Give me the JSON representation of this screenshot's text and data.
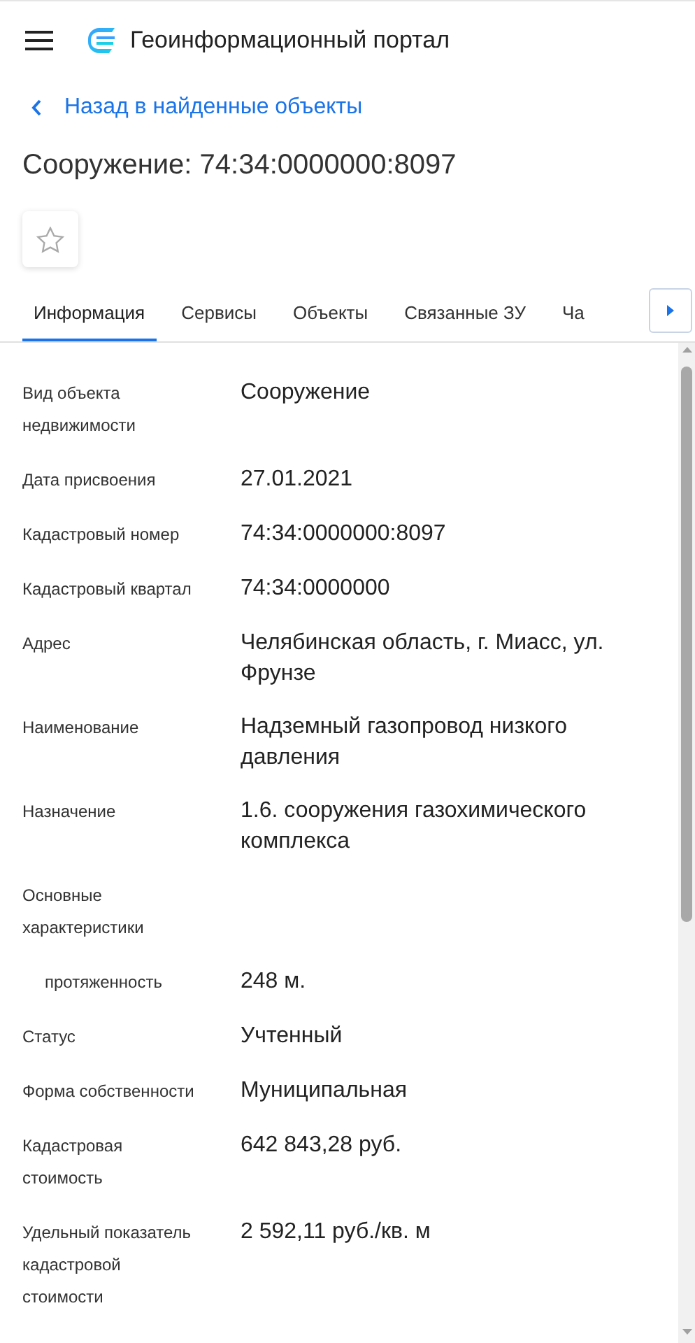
{
  "header": {
    "title": "Геоинформационный портал"
  },
  "back_link": "Назад в найденные объекты",
  "heading": "Сооружение: 74:34:0000000:8097",
  "favorite": {
    "on": false
  },
  "tabs": [
    {
      "label": "Информация",
      "selected": true
    },
    {
      "label": "Сервисы",
      "selected": false
    },
    {
      "label": "Объекты",
      "selected": false
    },
    {
      "label": "Связанные ЗУ",
      "selected": false
    },
    {
      "label": "Ча",
      "selected": false
    }
  ],
  "fields": [
    {
      "kind": "field",
      "label": "Вид объекта недвижимости",
      "value": "Сооружение"
    },
    {
      "kind": "field",
      "label": "Дата присвоения",
      "value": "27.01.2021"
    },
    {
      "kind": "field",
      "label": "Кадастровый номер",
      "value": "74:34:0000000:8097"
    },
    {
      "kind": "field",
      "label": "Кадастровый квартал",
      "value": "74:34:0000000"
    },
    {
      "kind": "field",
      "label": "Адрес",
      "value": "Челябинская область, г. Миасс, ул. Фрунзе"
    },
    {
      "kind": "field",
      "label": "Наименование",
      "value": "Надземный газопровод низкого давления"
    },
    {
      "kind": "field",
      "label": "Назначение",
      "value": "1.6. сооружения газохимического комплекса"
    },
    {
      "kind": "group",
      "label": "Основные характеристики"
    },
    {
      "kind": "sub",
      "label": "протяженность",
      "value": "248 м."
    },
    {
      "kind": "field",
      "label": "Статус",
      "value": "Учтенный"
    },
    {
      "kind": "field",
      "label": "Форма собственности",
      "value": "Муниципальная"
    },
    {
      "kind": "field",
      "label": "Кадастровая стоимость",
      "value": "642 843,28 руб."
    },
    {
      "kind": "field",
      "label": "Удельный показатель кадастровой стоимости",
      "value": "2 592,11 руб./кв. м"
    }
  ]
}
